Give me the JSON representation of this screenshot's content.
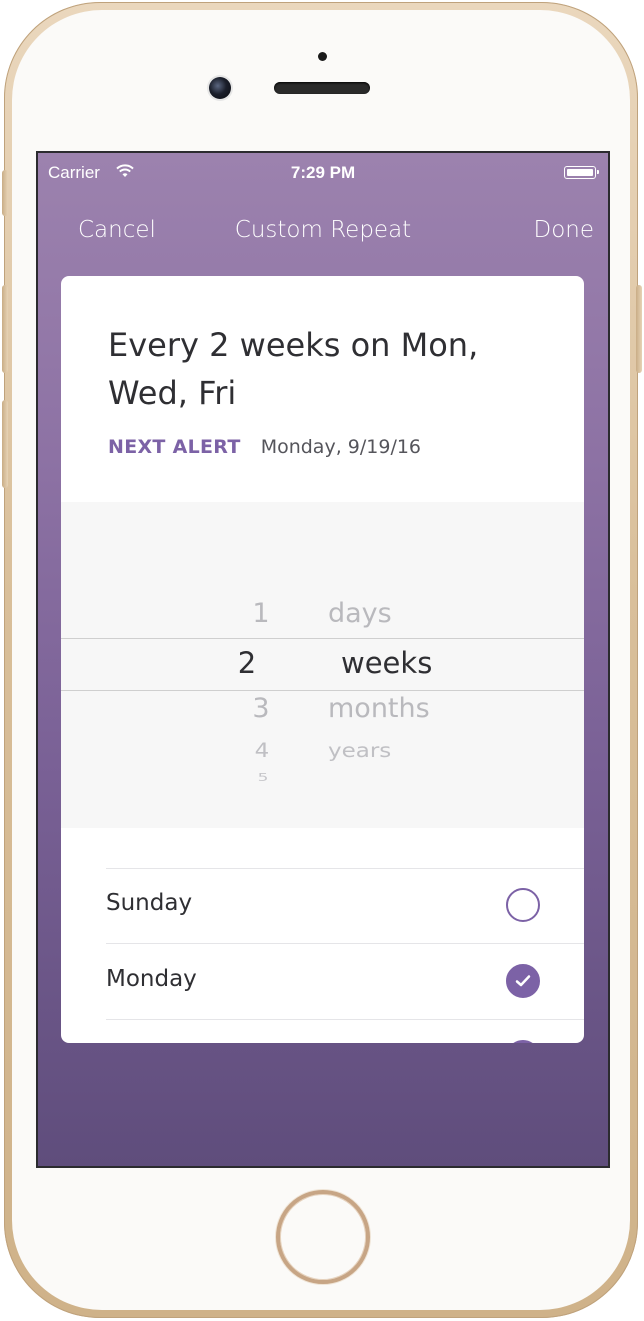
{
  "status_bar": {
    "carrier": "Carrier",
    "time": "7:29 PM"
  },
  "nav": {
    "cancel": "Cancel",
    "title": "Custom Repeat",
    "done": "Done"
  },
  "summary": {
    "line1": "Every 2 weeks on Mon,",
    "line2": "Wed, Fri",
    "next_alert_label": "NEXT ALERT",
    "next_alert_value": "Monday, 9/19/16"
  },
  "picker": {
    "numbers": [
      "1",
      "2",
      "3",
      "4",
      "5"
    ],
    "units": [
      "days",
      "weeks",
      "months",
      "years"
    ],
    "selected_number": "2",
    "selected_unit": "weeks"
  },
  "days": [
    {
      "label": "Sunday",
      "checked": false
    },
    {
      "label": "Monday",
      "checked": true
    }
  ],
  "colors": {
    "accent": "#7c62a6",
    "background_top": "#9c82ae",
    "background_bottom": "#5f4d7c"
  },
  "icons": [
    "wifi-icon",
    "battery-icon",
    "checkmark-icon"
  ]
}
